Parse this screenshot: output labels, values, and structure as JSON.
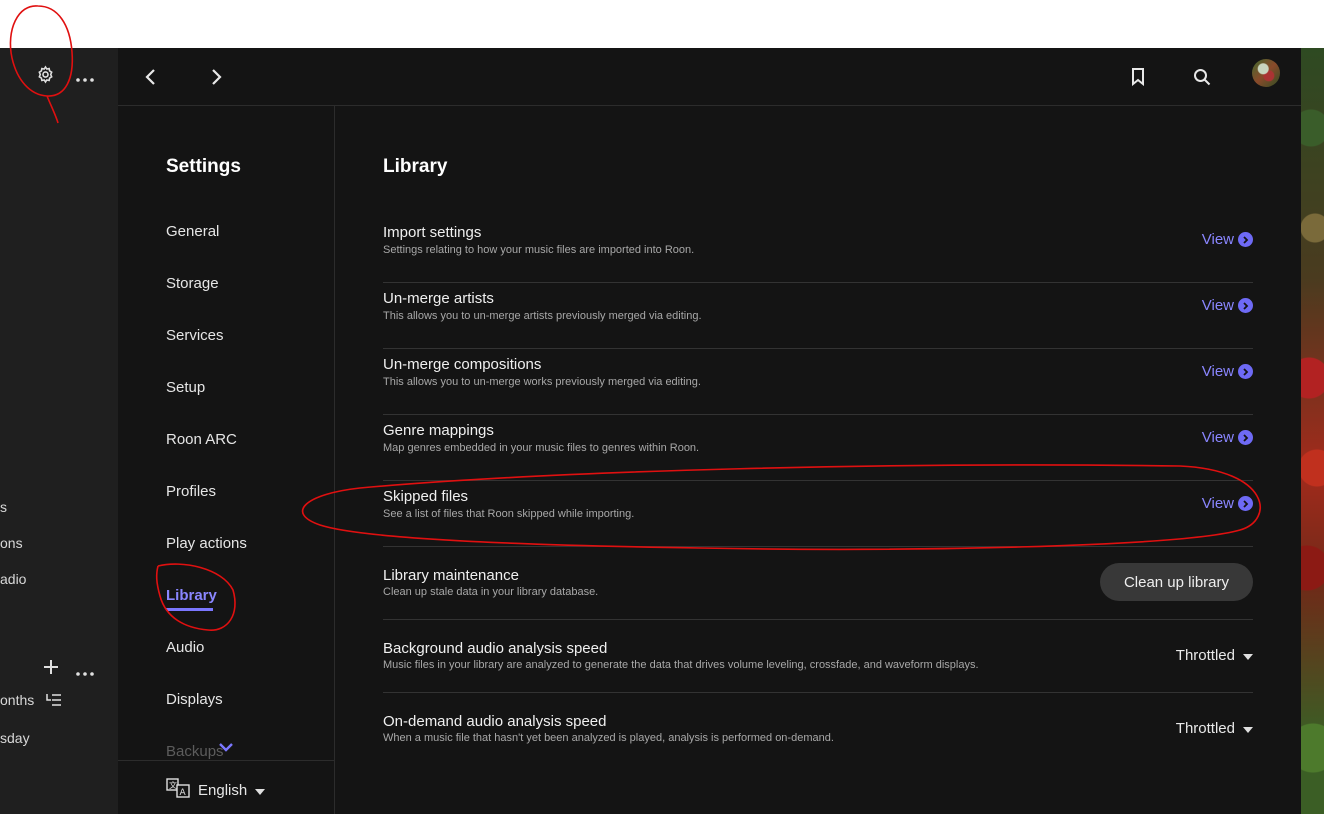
{
  "left_panel": {
    "partial_items": [
      "s",
      "ons",
      "adio",
      "onths",
      "sday"
    ]
  },
  "topbar": {
    "back_icon": "chevron-left-icon",
    "forward_icon": "chevron-right-icon",
    "bookmark_icon": "bookmark-icon",
    "search_icon": "search-icon"
  },
  "settings_sidebar": {
    "title": "Settings",
    "items": [
      {
        "label": "General"
      },
      {
        "label": "Storage"
      },
      {
        "label": "Services"
      },
      {
        "label": "Setup"
      },
      {
        "label": "Roon ARC"
      },
      {
        "label": "Profiles"
      },
      {
        "label": "Play actions"
      },
      {
        "label": "Library"
      },
      {
        "label": "Audio"
      },
      {
        "label": "Displays"
      },
      {
        "label": "Backups"
      }
    ],
    "active": "Library",
    "language": "English"
  },
  "library": {
    "title": "Library",
    "rows": [
      {
        "title": "Import settings",
        "desc": "Settings relating to how your music files are imported into Roon.",
        "action": "View"
      },
      {
        "title": "Un-merge artists",
        "desc": "This allows you to un-merge artists previously merged via editing.",
        "action": "View"
      },
      {
        "title": "Un-merge compositions",
        "desc": "This allows you to un-merge works previously merged via editing.",
        "action": "View"
      },
      {
        "title": "Genre mappings",
        "desc": "Map genres embedded in your music files to genres within Roon.",
        "action": "View"
      },
      {
        "title": "Skipped files",
        "desc": "See a list of files that Roon skipped while importing.",
        "action": "View"
      },
      {
        "title": "Library maintenance",
        "desc": "Clean up stale data in your library database.",
        "action": "Clean up library"
      },
      {
        "title": "Background audio analysis speed",
        "desc": "Music files in your library are analyzed to generate the data that drives volume leveling, crossfade, and waveform displays.",
        "action": "Throttled"
      },
      {
        "title": "On-demand audio analysis speed",
        "desc": "When a music file that hasn't yet been analyzed is played, analysis is performed on-demand.",
        "action": "Throttled"
      }
    ]
  },
  "colors": {
    "accent": "#7b77ff",
    "annotation": "#e01010",
    "background": "#141414"
  }
}
